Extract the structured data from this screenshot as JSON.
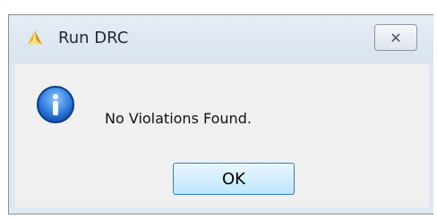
{
  "window": {
    "title": "Run DRC",
    "icon": "app-logo-icon",
    "close_icon": "close-icon"
  },
  "dialog": {
    "icon": "info-icon",
    "message": "No Violations Found.",
    "ok_label": "OK"
  },
  "colors": {
    "accent": "#1f62c4",
    "logo": "#f2b51f",
    "dialog_bg": "#f0f0f0"
  }
}
